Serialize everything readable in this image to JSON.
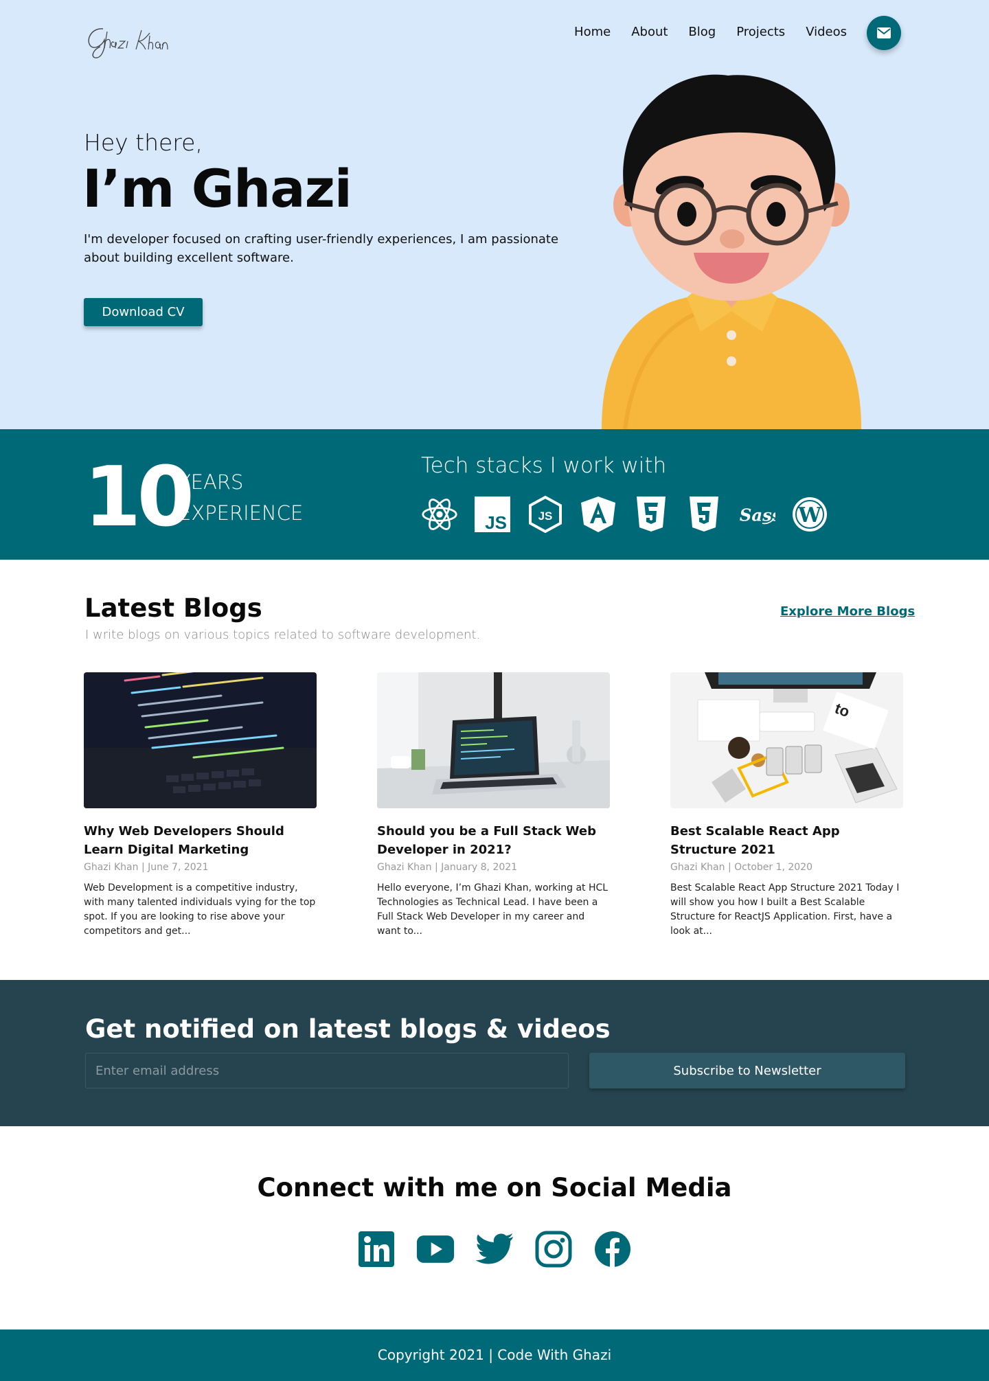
{
  "brand": {
    "logo_text": "Ghazi Khan"
  },
  "nav": {
    "items": [
      "Home",
      "About",
      "Blog",
      "Projects",
      "Videos"
    ],
    "mail_icon": "mail-icon"
  },
  "hero": {
    "greeting": "Hey there,",
    "name": "I’m Ghazi",
    "intro": "I'm developer focused on crafting user-friendly experiences, I am passionate about building excellent software.",
    "cta_label": "Download CV"
  },
  "stats": {
    "years_number": "10",
    "years_line1": "YEARS",
    "years_line2": "EXPERIENCE",
    "stack_title": "Tech stacks I work with",
    "stack_icons": [
      "react-icon",
      "javascript-icon",
      "nodejs-icon",
      "angular-icon",
      "html5-icon",
      "css3-icon",
      "sass-icon",
      "wordpress-icon"
    ]
  },
  "blogs": {
    "title": "Latest Blogs",
    "subtitle": "I write blogs on various topics related to software development.",
    "more_link": "Explore More Blogs",
    "posts": [
      {
        "title": "Why Web Developers Should Learn Digital Marketing",
        "meta": "Ghazi Khan | June 7, 2021",
        "excerpt": "Web Development is a competitive industry, with many talented individuals vying for the top spot. If you are looking to rise above your competitors and get..."
      },
      {
        "title": "Should you be a Full Stack Web Developer in 2021?",
        "meta": "Ghazi Khan | January 8, 2021",
        "excerpt": "Hello everyone, I’m Ghazi Khan, working at HCL Technologies as Technical Lead. I have been a Full Stack Web Developer in my career and want to..."
      },
      {
        "title": "Best Scalable React App Structure 2021",
        "meta": "Ghazi Khan | October 1, 2020",
        "excerpt": "Best Scalable React App Structure 2021 Today I will show you how I built a Best Scalable Structure for ReactJS Application. First, have a look at..."
      }
    ]
  },
  "newsletter": {
    "title": "Get notified on latest blogs & videos",
    "placeholder": "Enter email address",
    "button": "Subscribe to Newsletter"
  },
  "social": {
    "title": "Connect with me on Social Media",
    "icons": [
      "linkedin-icon",
      "youtube-icon",
      "twitter-icon",
      "instagram-icon",
      "facebook-icon"
    ]
  },
  "footer": {
    "text": "Copyright 2021 | Code With Ghazi"
  },
  "colors": {
    "teal": "#006978",
    "hero_bg": "#d7e9fb",
    "newsletter_bg": "#26444f"
  }
}
